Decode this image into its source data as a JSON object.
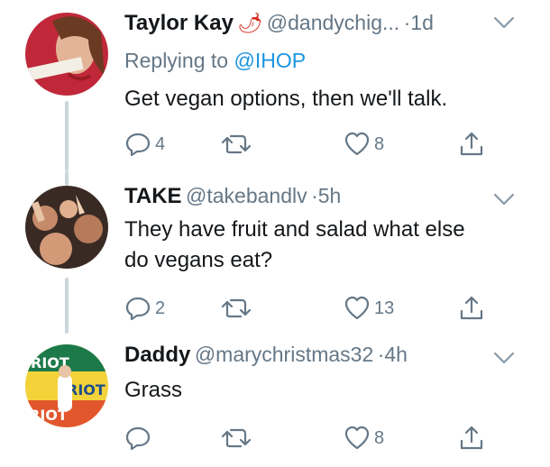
{
  "tweets": [
    {
      "name": "Taylor Kay",
      "name_emoji": "🌶",
      "handle": "@dandychig...",
      "time": "1d",
      "replying_prefix": "Replying to",
      "replying_to": "@IHOP",
      "text": "Get vegan options, then we'll talk.",
      "reply_count": "4",
      "like_count": "8",
      "icons": [
        "reply-icon",
        "retweet-icon",
        "like-icon",
        "share-icon"
      ]
    },
    {
      "name": "TAKE",
      "handle": "@takebandlv",
      "time": "5h",
      "text_line1": "They have fruit and salad what else",
      "text_line2": "do vegans eat?",
      "reply_count": "2",
      "like_count": "13"
    },
    {
      "name": "Daddy",
      "handle": "@marychristmas32",
      "time": "4h",
      "text": "Grass",
      "like_count": "8",
      "avatar_banner_text": "RIOT"
    }
  ],
  "separator": "·",
  "colors": {
    "accent": "#1b95e0",
    "muted": "#657786",
    "text": "#14171a",
    "thread_line": "#ccd6dd"
  }
}
